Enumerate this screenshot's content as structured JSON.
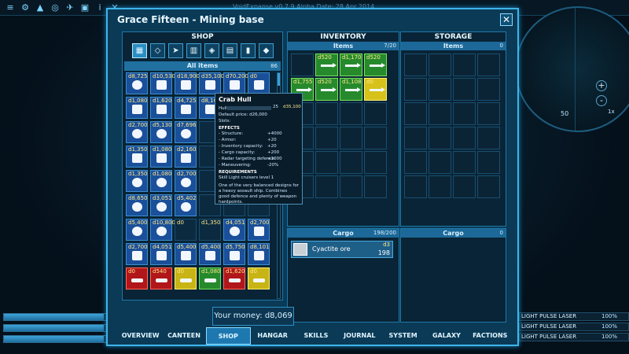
{
  "topbar": {
    "version_info": "VoidExpanse v0.7.9 Alpha Date: 28 Apr 2014",
    "icons": [
      "menu-icon",
      "settings-icon",
      "map-icon",
      "target-icon",
      "ship-icon",
      "cargo-icon",
      "info-icon",
      "close-icon"
    ]
  },
  "radar": {
    "distance": "50",
    "multiplier": "1x",
    "zoom_in": "+",
    "zoom_out": "-"
  },
  "window": {
    "title": "Grace Fifteen - Mining base",
    "close_label": "✕"
  },
  "shop": {
    "title": "SHOP",
    "category_icons": [
      "grid-icon",
      "hull-icon",
      "weapon-icon",
      "engine-icon",
      "shield-icon",
      "device-icon",
      "ammo-icon",
      "misc-icon"
    ],
    "all_items_label": "All items",
    "all_items_count": "86",
    "items": [
      {
        "price": "d8,725",
        "color": "blue",
        "shape": "round"
      },
      {
        "price": "d10,530",
        "color": "blue",
        "shape": "square"
      },
      {
        "price": "d18,900",
        "color": "blue",
        "shape": "square"
      },
      {
        "price": "d35,100",
        "color": "blue",
        "shape": "square"
      },
      {
        "price": "d70,200",
        "color": "blue",
        "shape": "square"
      },
      {
        "price": "d0",
        "color": "blue",
        "shape": "square"
      },
      {
        "price": "d1,080",
        "color": "blue",
        "shape": "square"
      },
      {
        "price": "d1,620",
        "color": "blue",
        "shape": "square"
      },
      {
        "price": "d4,725",
        "color": "blue",
        "shape": "square"
      },
      {
        "price": "d8,100",
        "color": "blue",
        "shape": "square"
      },
      {
        "price": "",
        "color": "empty",
        "shape": ""
      },
      {
        "price": "",
        "color": "empty",
        "shape": ""
      },
      {
        "price": "d2,700",
        "color": "blue",
        "shape": "round"
      },
      {
        "price": "d5,130",
        "color": "blue",
        "shape": "round"
      },
      {
        "price": "d7,696",
        "color": "blue",
        "shape": "round"
      },
      {
        "price": "",
        "color": "empty",
        "shape": ""
      },
      {
        "price": "",
        "color": "empty",
        "shape": ""
      },
      {
        "price": "",
        "color": "empty",
        "shape": ""
      },
      {
        "price": "d1,350",
        "color": "blue",
        "shape": "square"
      },
      {
        "price": "d1,080",
        "color": "blue",
        "shape": "square"
      },
      {
        "price": "d2,160",
        "color": "blue",
        "shape": "square"
      },
      {
        "price": "",
        "color": "empty",
        "shape": ""
      },
      {
        "price": "",
        "color": "empty",
        "shape": ""
      },
      {
        "price": "",
        "color": "empty",
        "shape": ""
      },
      {
        "price": "d1,350",
        "color": "blue",
        "shape": "round"
      },
      {
        "price": "d1,080",
        "color": "blue",
        "shape": "round"
      },
      {
        "price": "d2,700",
        "color": "blue",
        "shape": "round"
      },
      {
        "price": "",
        "color": "empty",
        "shape": ""
      },
      {
        "price": "",
        "color": "empty",
        "shape": ""
      },
      {
        "price": "",
        "color": "empty",
        "shape": ""
      },
      {
        "price": "d8,650",
        "color": "blue",
        "shape": "round"
      },
      {
        "price": "d3,051",
        "color": "blue",
        "shape": "round"
      },
      {
        "price": "d5,402",
        "color": "blue",
        "shape": "round"
      },
      {
        "price": "",
        "color": "empty",
        "shape": ""
      },
      {
        "price": "",
        "color": "empty",
        "shape": ""
      },
      {
        "price": "",
        "color": "empty",
        "shape": ""
      },
      {
        "price": "d5,400",
        "color": "blue",
        "shape": "round"
      },
      {
        "price": "d10,800",
        "color": "blue",
        "shape": "round"
      },
      {
        "price": "d0",
        "color": "empty",
        "shape": ""
      },
      {
        "price": "d1,350",
        "color": "empty",
        "shape": ""
      },
      {
        "price": "d4,051",
        "color": "blue",
        "shape": "round"
      },
      {
        "price": "d2,700",
        "color": "blue",
        "shape": "square"
      },
      {
        "price": "d2,700",
        "color": "blue",
        "shape": "square"
      },
      {
        "price": "d4,051",
        "color": "blue",
        "shape": "square"
      },
      {
        "price": "d5,400",
        "color": "blue",
        "shape": "square"
      },
      {
        "price": "d5,400",
        "color": "blue",
        "shape": "square"
      },
      {
        "price": "d5,750",
        "color": "blue",
        "shape": "square"
      },
      {
        "price": "d8,101",
        "color": "blue",
        "shape": "square"
      },
      {
        "price": "d0",
        "color": "red",
        "shape": "bar"
      },
      {
        "price": "d540",
        "color": "red",
        "shape": "bar"
      },
      {
        "price": "d0",
        "color": "yellow",
        "shape": "bar"
      },
      {
        "price": "d1,080",
        "color": "green",
        "shape": "bar"
      },
      {
        "price": "d1,620",
        "color": "red",
        "shape": "bar"
      },
      {
        "price": "d0",
        "color": "yellow",
        "shape": "bar"
      }
    ]
  },
  "inventory": {
    "title": "INVENTORY",
    "items_label": "Items",
    "items_count": "7/20",
    "slots": [
      {
        "price": "",
        "color": "empty"
      },
      {
        "price": "d520",
        "color": "green"
      },
      {
        "price": "d1,170",
        "color": "green"
      },
      {
        "price": "d520",
        "color": "green"
      },
      {
        "price": "d1,755",
        "color": "green"
      },
      {
        "price": "d520",
        "color": "green"
      },
      {
        "price": "d1,108",
        "color": "green"
      },
      {
        "price": "d0",
        "color": "yellow"
      }
    ],
    "cargo_label": "Cargo",
    "cargo_count": "198/200",
    "cargo_items": [
      {
        "name": "Cyactite ore",
        "price": "d3",
        "qty": "198"
      }
    ]
  },
  "storage": {
    "title": "STORAGE",
    "items_label": "Items",
    "items_count": "0",
    "cargo_label": "Cargo",
    "cargo_count": "0"
  },
  "money": {
    "label": "Your money: d8,069"
  },
  "tabs": [
    {
      "label": "OVERVIEW",
      "active": false
    },
    {
      "label": "CANTEEN",
      "active": false
    },
    {
      "label": "SHOP",
      "active": true
    },
    {
      "label": "HANGAR",
      "active": false
    },
    {
      "label": "SKILLS",
      "active": false
    },
    {
      "label": "JOURNAL",
      "active": false
    },
    {
      "label": "SYSTEM",
      "active": false
    },
    {
      "label": "GALAXY",
      "active": false
    },
    {
      "label": "FACTIONS",
      "active": false
    }
  ],
  "tooltip": {
    "title": "Crab Hull",
    "hull_label": "Hull",
    "hull_value": "25",
    "hull_price": "d35,100",
    "default_price": "Default price: d26,000",
    "slots_label": "Slots:",
    "effects_label": "EFFECTS",
    "effects": [
      {
        "name": "- Structure:",
        "value": "+4000"
      },
      {
        "name": "- Armor:",
        "value": "+20"
      },
      {
        "name": "- Inventory capacity:",
        "value": "+20"
      },
      {
        "name": "- Cargo capacity:",
        "value": "+200"
      },
      {
        "name": "- Radar targeting defence:",
        "value": "+1000"
      },
      {
        "name": "- Maneuvering:",
        "value": "-20%"
      }
    ],
    "requirements_label": "REQUIREMENTS",
    "requirement": "Skill Light cruisers  level 1",
    "description": "One of the very balanced designs for a heavy assault ship. Combines good defence and plenty of weapon hardpoints."
  },
  "weapons": [
    {
      "label": "LIGHT PULSE LASER",
      "percent": "100%"
    },
    {
      "label": "LIGHT PULSE LASER",
      "percent": "100%"
    },
    {
      "label": "LIGHT PULSE LASER",
      "percent": "100%"
    }
  ],
  "ship_status": {
    "bar_levels": [
      0.95,
      0.95,
      0.95
    ]
  }
}
